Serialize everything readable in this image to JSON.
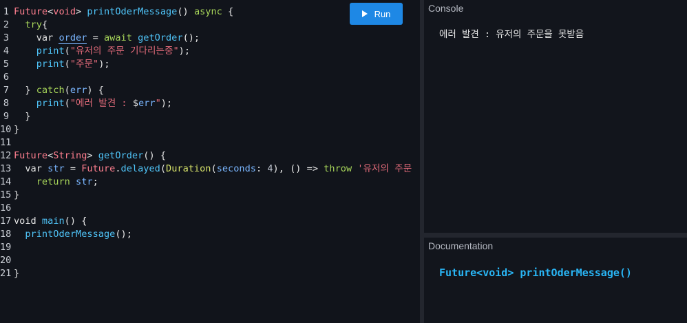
{
  "editor": {
    "lines": [
      [
        {
          "c": "tok-typ",
          "t": "Future"
        },
        {
          "c": "tok-pl",
          "t": "<"
        },
        {
          "c": "tok-typ",
          "t": "void"
        },
        {
          "c": "tok-pl",
          "t": "> "
        },
        {
          "c": "tok-fn",
          "t": "printOderMessage"
        },
        {
          "c": "tok-pl",
          "t": "() "
        },
        {
          "c": "tok-grn",
          "t": "async"
        },
        {
          "c": "tok-pl",
          "t": " {"
        }
      ],
      [
        {
          "c": "tok-pl",
          "t": "  "
        },
        {
          "c": "tok-grn",
          "t": "try"
        },
        {
          "c": "tok-pl",
          "t": "{"
        }
      ],
      [
        {
          "c": "tok-pl",
          "t": "    var "
        },
        {
          "c": "tok-und",
          "t": "order"
        },
        {
          "c": "tok-pl",
          "t": " = "
        },
        {
          "c": "tok-grn",
          "t": "await"
        },
        {
          "c": "tok-pl",
          "t": " "
        },
        {
          "c": "tok-fn",
          "t": "getOrder"
        },
        {
          "c": "tok-pl",
          "t": "();"
        }
      ],
      [
        {
          "c": "tok-pl",
          "t": "    "
        },
        {
          "c": "tok-fn",
          "t": "print"
        },
        {
          "c": "tok-pl",
          "t": "("
        },
        {
          "c": "tok-str",
          "t": "\"유저의 주문 기다리는중\""
        },
        {
          "c": "tok-pl",
          "t": ");"
        }
      ],
      [
        {
          "c": "tok-pl",
          "t": "    "
        },
        {
          "c": "tok-fn",
          "t": "print"
        },
        {
          "c": "tok-pl",
          "t": "("
        },
        {
          "c": "tok-str",
          "t": "\"주문\""
        },
        {
          "c": "tok-pl",
          "t": ");"
        }
      ],
      [],
      [
        {
          "c": "tok-pl",
          "t": "  } "
        },
        {
          "c": "tok-grn",
          "t": "catch"
        },
        {
          "c": "tok-pl",
          "t": "("
        },
        {
          "c": "tok-var",
          "t": "err"
        },
        {
          "c": "tok-pl",
          "t": ") {"
        }
      ],
      [
        {
          "c": "tok-pl",
          "t": "    "
        },
        {
          "c": "tok-fn",
          "t": "print"
        },
        {
          "c": "tok-pl",
          "t": "("
        },
        {
          "c": "tok-str",
          "t": "\"에러 발견 : "
        },
        {
          "c": "tok-pl",
          "t": "$"
        },
        {
          "c": "tok-var",
          "t": "err"
        },
        {
          "c": "tok-str",
          "t": "\""
        },
        {
          "c": "tok-pl",
          "t": ");"
        }
      ],
      [
        {
          "c": "tok-pl",
          "t": "  }"
        }
      ],
      [
        {
          "c": "tok-pl",
          "t": "}"
        }
      ],
      [],
      [
        {
          "c": "tok-typ",
          "t": "Future"
        },
        {
          "c": "tok-pl",
          "t": "<"
        },
        {
          "c": "tok-typ",
          "t": "String"
        },
        {
          "c": "tok-pl",
          "t": "> "
        },
        {
          "c": "tok-fn",
          "t": "getOrder"
        },
        {
          "c": "tok-pl",
          "t": "() {"
        }
      ],
      [
        {
          "c": "tok-pl",
          "t": "  var "
        },
        {
          "c": "tok-var",
          "t": "str"
        },
        {
          "c": "tok-pl",
          "t": " = "
        },
        {
          "c": "tok-typ",
          "t": "Future"
        },
        {
          "c": "tok-pl",
          "t": "."
        },
        {
          "c": "tok-fn",
          "t": "delayed"
        },
        {
          "c": "tok-pl",
          "t": "("
        },
        {
          "c": "tok-yel",
          "t": "Duration"
        },
        {
          "c": "tok-pl",
          "t": "("
        },
        {
          "c": "tok-var",
          "t": "seconds"
        },
        {
          "c": "tok-pl",
          "t": ": "
        },
        {
          "c": "tok-num",
          "t": "4"
        },
        {
          "c": "tok-pl",
          "t": "), () => "
        },
        {
          "c": "tok-grn",
          "t": "throw"
        },
        {
          "c": "tok-pl",
          "t": " "
        },
        {
          "c": "tok-str",
          "t": "'유저의 주문"
        }
      ],
      [
        {
          "c": "tok-pl",
          "t": "    "
        },
        {
          "c": "tok-grn",
          "t": "return"
        },
        {
          "c": "tok-pl",
          "t": " "
        },
        {
          "c": "tok-var",
          "t": "str"
        },
        {
          "c": "tok-pl",
          "t": ";"
        }
      ],
      [
        {
          "c": "tok-pl",
          "t": "}"
        }
      ],
      [],
      [
        {
          "c": "tok-pl",
          "t": "void "
        },
        {
          "c": "tok-fn",
          "t": "main"
        },
        {
          "c": "tok-pl",
          "t": "() {"
        }
      ],
      [
        {
          "c": "tok-pl",
          "t": "  "
        },
        {
          "c": "tok-fn",
          "t": "printOderMessage"
        },
        {
          "c": "tok-pl",
          "t": "();"
        }
      ],
      [],
      [],
      [
        {
          "c": "tok-pl",
          "t": "}"
        }
      ]
    ]
  },
  "toolbar": {
    "run_label": "Run"
  },
  "console": {
    "title": "Console",
    "output": "에러 발견 : 유저의 주문을 못받음"
  },
  "docs": {
    "title": "Documentation",
    "signature": "Future<void> printOderMessage()"
  },
  "colors": {
    "accent": "#1e88e5",
    "keyword_green": "#a8d65a",
    "function_blue": "#4fc3f7",
    "type_pink": "#ff7f8f",
    "string_red": "#e36b7a"
  }
}
